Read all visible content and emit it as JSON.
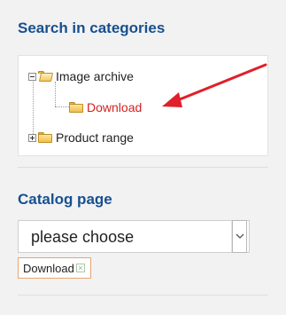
{
  "search_categories": {
    "title": "Search in categories",
    "tree": [
      {
        "label": "Image archive",
        "expanded": true,
        "icon": "folder-open-icon"
      },
      {
        "label": "Download",
        "selected": true,
        "icon": "folder-icon"
      },
      {
        "label": "Product range",
        "expanded": false,
        "icon": "folder-icon"
      }
    ]
  },
  "catalog_page": {
    "title": "Catalog page",
    "select_value": "please choose",
    "tag_label": "Download"
  },
  "colors": {
    "title": "#17508f",
    "selected": "#d42020",
    "arrow": "#e0202a"
  }
}
